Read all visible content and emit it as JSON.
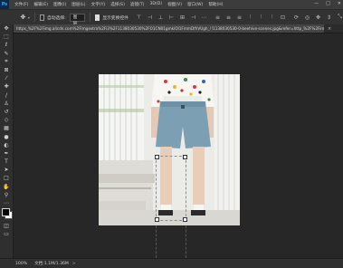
{
  "app": {
    "logo": "Ps",
    "menus": [
      "文件(F)",
      "编辑(E)",
      "图像(I)",
      "图层(L)",
      "文字(Y)",
      "选择(S)",
      "滤镜(T)",
      "3D(D)",
      "视图(V)",
      "窗口(W)",
      "帮助(H)"
    ],
    "window_controls": [
      "—",
      "□",
      "✕"
    ]
  },
  "options": {
    "auto_select_label": "自动选择:",
    "layer_select_value": "图层",
    "show_transform_label": "显示变换控件",
    "show_transform_checked": true
  },
  "document": {
    "tab_title": "https_%2F%2Fimg.alicdn.com%2Fimgextra%2Fi3%2F1138030530%2FO1CN01gmkiOI1FmmDfhVUgh_!!1138030530-0-beehive-scenes.jpg&refer=http_%2F%2Fimg.alicdn.com...",
    "close_label": "×"
  },
  "status": {
    "zoom": "100%",
    "doc_info": "文档:1.1M/1.36M",
    "arrow": ">"
  },
  "tools": [
    "move-tool",
    "marquee-tool",
    "lasso-tool",
    "quick-select-tool",
    "crop-tool",
    "frame-tool",
    "eyedropper-tool",
    "healing-brush-tool",
    "brush-tool",
    "clone-stamp-tool",
    "history-brush-tool",
    "eraser-tool",
    "gradient-tool",
    "blur-tool",
    "dodge-tool",
    "pen-tool",
    "type-tool",
    "path-selection-tool",
    "rectangle-tool",
    "hand-tool",
    "zoom-tool",
    "more-tools"
  ],
  "colors": {
    "accent": "#31a8ff",
    "foreground": "#000000",
    "background": "#ffffff",
    "canvas_bg": "#272727"
  }
}
